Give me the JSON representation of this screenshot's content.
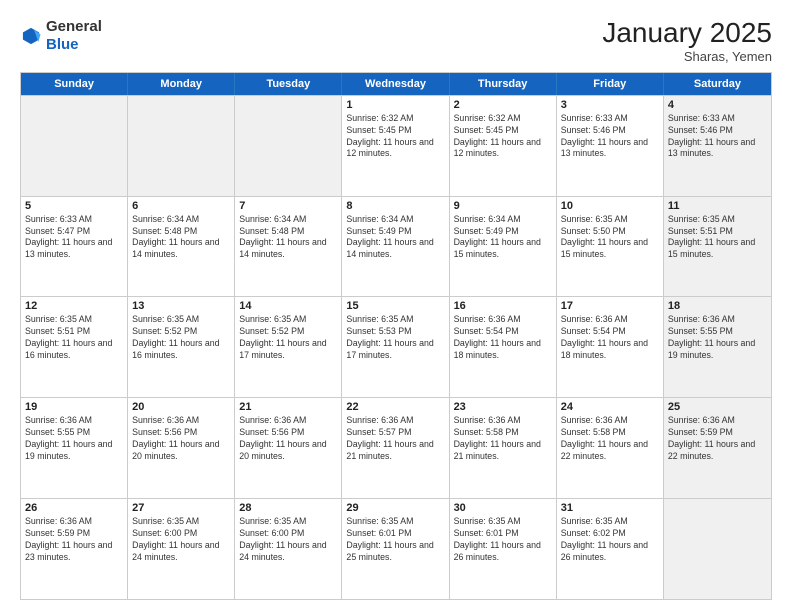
{
  "header": {
    "logo": {
      "line1": "General",
      "line2": "Blue"
    },
    "title": "January 2025",
    "subtitle": "Sharas, Yemen"
  },
  "weekdays": [
    "Sunday",
    "Monday",
    "Tuesday",
    "Wednesday",
    "Thursday",
    "Friday",
    "Saturday"
  ],
  "weeks": [
    [
      {
        "day": "",
        "info": "",
        "shaded": true
      },
      {
        "day": "",
        "info": "",
        "shaded": true
      },
      {
        "day": "",
        "info": "",
        "shaded": true
      },
      {
        "day": "1",
        "info": "Sunrise: 6:32 AM\nSunset: 5:45 PM\nDaylight: 11 hours and 12 minutes."
      },
      {
        "day": "2",
        "info": "Sunrise: 6:32 AM\nSunset: 5:45 PM\nDaylight: 11 hours and 12 minutes."
      },
      {
        "day": "3",
        "info": "Sunrise: 6:33 AM\nSunset: 5:46 PM\nDaylight: 11 hours and 13 minutes."
      },
      {
        "day": "4",
        "info": "Sunrise: 6:33 AM\nSunset: 5:46 PM\nDaylight: 11 hours and 13 minutes.",
        "shaded": true
      }
    ],
    [
      {
        "day": "5",
        "info": "Sunrise: 6:33 AM\nSunset: 5:47 PM\nDaylight: 11 hours and 13 minutes."
      },
      {
        "day": "6",
        "info": "Sunrise: 6:34 AM\nSunset: 5:48 PM\nDaylight: 11 hours and 14 minutes."
      },
      {
        "day": "7",
        "info": "Sunrise: 6:34 AM\nSunset: 5:48 PM\nDaylight: 11 hours and 14 minutes."
      },
      {
        "day": "8",
        "info": "Sunrise: 6:34 AM\nSunset: 5:49 PM\nDaylight: 11 hours and 14 minutes."
      },
      {
        "day": "9",
        "info": "Sunrise: 6:34 AM\nSunset: 5:49 PM\nDaylight: 11 hours and 15 minutes."
      },
      {
        "day": "10",
        "info": "Sunrise: 6:35 AM\nSunset: 5:50 PM\nDaylight: 11 hours and 15 minutes."
      },
      {
        "day": "11",
        "info": "Sunrise: 6:35 AM\nSunset: 5:51 PM\nDaylight: 11 hours and 15 minutes.",
        "shaded": true
      }
    ],
    [
      {
        "day": "12",
        "info": "Sunrise: 6:35 AM\nSunset: 5:51 PM\nDaylight: 11 hours and 16 minutes."
      },
      {
        "day": "13",
        "info": "Sunrise: 6:35 AM\nSunset: 5:52 PM\nDaylight: 11 hours and 16 minutes."
      },
      {
        "day": "14",
        "info": "Sunrise: 6:35 AM\nSunset: 5:52 PM\nDaylight: 11 hours and 17 minutes."
      },
      {
        "day": "15",
        "info": "Sunrise: 6:35 AM\nSunset: 5:53 PM\nDaylight: 11 hours and 17 minutes."
      },
      {
        "day": "16",
        "info": "Sunrise: 6:36 AM\nSunset: 5:54 PM\nDaylight: 11 hours and 18 minutes."
      },
      {
        "day": "17",
        "info": "Sunrise: 6:36 AM\nSunset: 5:54 PM\nDaylight: 11 hours and 18 minutes."
      },
      {
        "day": "18",
        "info": "Sunrise: 6:36 AM\nSunset: 5:55 PM\nDaylight: 11 hours and 19 minutes.",
        "shaded": true
      }
    ],
    [
      {
        "day": "19",
        "info": "Sunrise: 6:36 AM\nSunset: 5:55 PM\nDaylight: 11 hours and 19 minutes."
      },
      {
        "day": "20",
        "info": "Sunrise: 6:36 AM\nSunset: 5:56 PM\nDaylight: 11 hours and 20 minutes."
      },
      {
        "day": "21",
        "info": "Sunrise: 6:36 AM\nSunset: 5:56 PM\nDaylight: 11 hours and 20 minutes."
      },
      {
        "day": "22",
        "info": "Sunrise: 6:36 AM\nSunset: 5:57 PM\nDaylight: 11 hours and 21 minutes."
      },
      {
        "day": "23",
        "info": "Sunrise: 6:36 AM\nSunset: 5:58 PM\nDaylight: 11 hours and 21 minutes."
      },
      {
        "day": "24",
        "info": "Sunrise: 6:36 AM\nSunset: 5:58 PM\nDaylight: 11 hours and 22 minutes."
      },
      {
        "day": "25",
        "info": "Sunrise: 6:36 AM\nSunset: 5:59 PM\nDaylight: 11 hours and 22 minutes.",
        "shaded": true
      }
    ],
    [
      {
        "day": "26",
        "info": "Sunrise: 6:36 AM\nSunset: 5:59 PM\nDaylight: 11 hours and 23 minutes."
      },
      {
        "day": "27",
        "info": "Sunrise: 6:35 AM\nSunset: 6:00 PM\nDaylight: 11 hours and 24 minutes."
      },
      {
        "day": "28",
        "info": "Sunrise: 6:35 AM\nSunset: 6:00 PM\nDaylight: 11 hours and 24 minutes."
      },
      {
        "day": "29",
        "info": "Sunrise: 6:35 AM\nSunset: 6:01 PM\nDaylight: 11 hours and 25 minutes."
      },
      {
        "day": "30",
        "info": "Sunrise: 6:35 AM\nSunset: 6:01 PM\nDaylight: 11 hours and 26 minutes."
      },
      {
        "day": "31",
        "info": "Sunrise: 6:35 AM\nSunset: 6:02 PM\nDaylight: 11 hours and 26 minutes."
      },
      {
        "day": "",
        "info": "",
        "shaded": true
      }
    ]
  ]
}
